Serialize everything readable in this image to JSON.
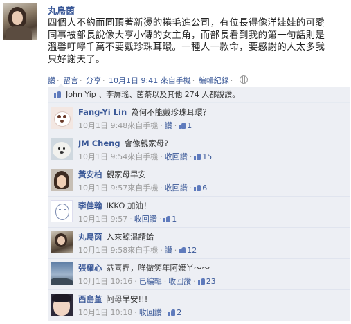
{
  "post": {
    "author": "丸鳥茵",
    "lines": [
      "四個人不約而同頂著新燙的捲毛進公司，有位長得像洋娃娃的可愛",
      "同事被部長說像大亨小傳的女主角，而部長看到我的第一句話則是",
      "溫馨叮嚀千萬不要戴珍珠耳環。一種人一款命，要感謝的人太多我",
      "只好謝天了。"
    ],
    "meta": {
      "like": "讚",
      "comment": "留言",
      "share": "分享",
      "time": "10月1日 9:41 來自手機",
      "edit_history": "編輯紀錄"
    },
    "likes": "John Yip 、李屏瑤、茵茶以及其他 274 人都說讚。"
  },
  "comments": [
    {
      "name": "Fang-Yi Lin",
      "text": "為何不能戴珍珠耳環？",
      "time": "10月1日 9:48來自手機",
      "action": "讚",
      "count": "1",
      "avatar": "dog"
    },
    {
      "name": "JM Cheng",
      "text": "會像親家母?",
      "time": "10月1日 9:54來自手機",
      "action": "收回讚",
      "count": "15",
      "avatar": "bear"
    },
    {
      "name": "黃安柏",
      "text": "親家母早安",
      "time": "10月1日 9:57來自手機",
      "action": "收回讚",
      "count": "6",
      "avatar": "girl"
    },
    {
      "name": "李佳翰",
      "text": "IKKO 加油！",
      "time": "10月1日 9:57",
      "action": "收回讚",
      "count": "1",
      "avatar": "sketch"
    },
    {
      "name": "丸鳥茵",
      "text": "入來鯨溫請蛤",
      "time": "10月1日 9:58來自手機",
      "action": "讚",
      "count": "12",
      "avatar": "self"
    },
    {
      "name": "張耀心",
      "text": "恭喜捏，咩做笑年阿嬤ㄚ～～",
      "time": "10月1日 10:16",
      "edited": "已編輯",
      "action": "收回讚",
      "count": "23",
      "avatar": "sky"
    },
    {
      "name": "西島堇",
      "text": "阿母早安!!!",
      "time": "10月1日 10:18",
      "action": "收回讚",
      "count": "2",
      "avatar": "face"
    }
  ],
  "colors": {
    "link": "#3b5998",
    "box": "#edeff4",
    "muted": "#999999"
  },
  "icons": {
    "privacy": "globe-icon",
    "like": "thumbs-up-icon"
  }
}
